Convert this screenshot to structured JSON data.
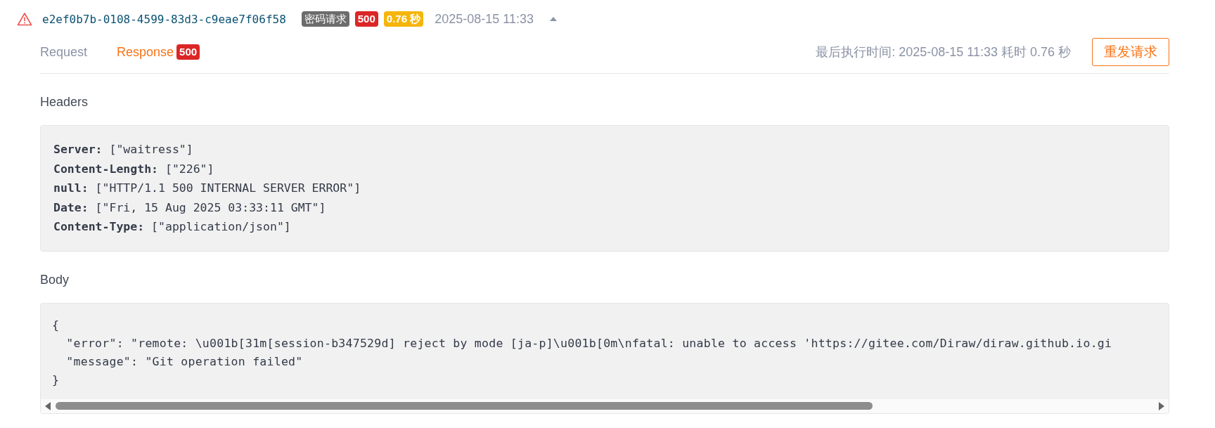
{
  "request": {
    "kind": "error",
    "id": "e2ef0b7b-0108-4599-83d3-c9eae7f06f58",
    "badges": [
      {
        "text": "密码请求",
        "color": "#6c6c6c"
      },
      {
        "text": "500",
        "color": "#dc2626"
      },
      {
        "text": "0.76 秒",
        "color": "#f5b50a"
      }
    ],
    "time": "2025-08-15 11:33",
    "expanded": true
  },
  "tabs": [
    {
      "label": "Request",
      "selected": false
    },
    {
      "label": "Response",
      "selected": true,
      "badge": "500"
    }
  ],
  "last_run": "最后执行时间: 2025-08-15 11:33 耗时 0.76 秒",
  "resend_button": "重发请求",
  "headers": {
    "title": "Headers",
    "lines": [
      {
        "key": "Server:",
        "value": "[\"waitress\"]"
      },
      {
        "key": "Content-Length:",
        "value": "[\"226\"]"
      },
      {
        "key": "null:",
        "value": "[\"HTTP/1.1 500 INTERNAL SERVER ERROR\"]"
      },
      {
        "key": "Date:",
        "value": "[\"Fri, 15 Aug 2025 03:33:11 GMT\"]"
      },
      {
        "key": "Content-Type:",
        "value": "[\"application/json\"]"
      }
    ]
  },
  "body": {
    "title": "Body",
    "lines": [
      "{",
      "  \"error\": \"remote: \\u001b[31m[session-b347529d] reject by mode [ja-p]\\u001b[0m\\nfatal: unable to access 'https://gitee.com/Diraw/diraw.github.io.gi",
      "  \"message\": \"Git operation failed\"",
      "}"
    ]
  }
}
